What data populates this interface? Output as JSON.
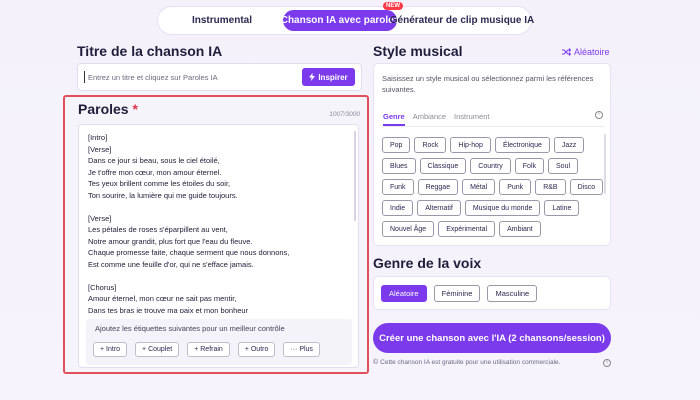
{
  "tabs": [
    {
      "label": "Instrumental"
    },
    {
      "label": "Chanson IA avec paroles",
      "badge": "NEW",
      "active": true
    },
    {
      "label": "Générateur de clip musique IA"
    }
  ],
  "song_title": {
    "heading": "Titre de la chanson IA",
    "placeholder": "Entrez un titre et cliquez sur Paroles IA",
    "inspire_label": "Inspirer"
  },
  "lyrics": {
    "heading": "Paroles",
    "required_mark": "*",
    "char_count": "1007/3000",
    "text": "[Intro]\n[Verse]\nDans ce jour si beau, sous le ciel étoilé,\nJe t'offre mon cœur, mon amour éternel.\nTes yeux brillent comme les étoiles du soir,\nTon sourire, la lumière qui me guide toujours.\n\n[Verse]\nLes pétales de roses s'éparpillent au vent,\nNotre amour grandit, plus fort que l'eau du fleuve.\nChaque promesse faite, chaque serment que nous donnons,\nEst comme une feuille d'or, qui ne s'efface jamais.\n\n[Chorus]\nAmour éternel, mon cœur ne sait pas mentir,\nDans tes bras je trouve ma paix et mon bonheur",
    "tags_hint": "Ajoutez les étiquettes suivantes pour un meilleur contrôle",
    "tag_buttons": [
      "+ Intro",
      "+ Couplet",
      "+ Refrain",
      "+ Outro",
      "··· Plus"
    ]
  },
  "style": {
    "heading": "Style musical",
    "random_label": "Aléatoire",
    "description": "Saisissez un style musical ou sélectionnez parmi les références suivantes.",
    "tabs": [
      "Genre",
      "Ambiance",
      "Instrument"
    ],
    "active_tab": "Genre",
    "genres": [
      "Pop",
      "Rock",
      "Hip-hop",
      "Électronique",
      "Jazz",
      "Blues",
      "Classique",
      "Country",
      "Folk",
      "Soul",
      "Funk",
      "Reggae",
      "Métal",
      "Punk",
      "R&B",
      "Disco",
      "Indie",
      "Alternatif",
      "Musique du monde",
      "Latine",
      "Nouvel Âge",
      "Expérimental",
      "Ambiant"
    ]
  },
  "voice": {
    "heading": "Genre de la voix",
    "options": [
      "Aléatoire",
      "Féminine",
      "Masculine"
    ],
    "selected": "Aléatoire"
  },
  "create_label": "Créer une chanson avec l'IA (2 chansons/session)",
  "note": "Cette chanson IA est gratuite pour une utilisation commerciale.",
  "colors": {
    "accent": "#7c3aed",
    "highlight_border": "#e24f5c",
    "badge": "#ff3b48"
  }
}
